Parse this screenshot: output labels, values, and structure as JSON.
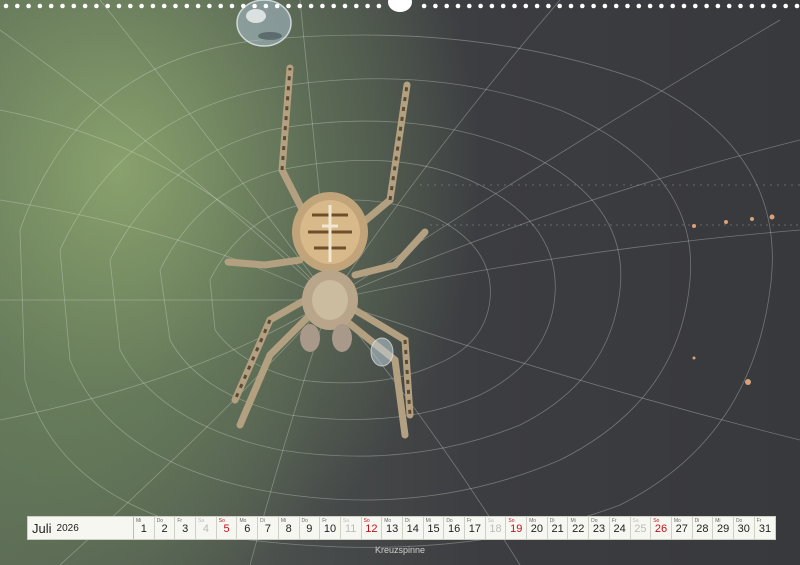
{
  "calendar": {
    "month": "Juli",
    "year": "2026",
    "days": [
      {
        "dow": "Mi",
        "num": "1",
        "type": "weekday"
      },
      {
        "dow": "Do",
        "num": "2",
        "type": "weekday"
      },
      {
        "dow": "Fr",
        "num": "3",
        "type": "weekday"
      },
      {
        "dow": "Sa",
        "num": "4",
        "type": "sat"
      },
      {
        "dow": "So",
        "num": "5",
        "type": "sun"
      },
      {
        "dow": "Mo",
        "num": "6",
        "type": "weekday"
      },
      {
        "dow": "Di",
        "num": "7",
        "type": "weekday"
      },
      {
        "dow": "Mi",
        "num": "8",
        "type": "weekday"
      },
      {
        "dow": "Do",
        "num": "9",
        "type": "weekday"
      },
      {
        "dow": "Fr",
        "num": "10",
        "type": "weekday"
      },
      {
        "dow": "Sa",
        "num": "11",
        "type": "sat"
      },
      {
        "dow": "So",
        "num": "12",
        "type": "sun"
      },
      {
        "dow": "Mo",
        "num": "13",
        "type": "weekday"
      },
      {
        "dow": "Di",
        "num": "14",
        "type": "weekday"
      },
      {
        "dow": "Mi",
        "num": "15",
        "type": "weekday"
      },
      {
        "dow": "Do",
        "num": "16",
        "type": "weekday"
      },
      {
        "dow": "Fr",
        "num": "17",
        "type": "weekday"
      },
      {
        "dow": "Sa",
        "num": "18",
        "type": "sat"
      },
      {
        "dow": "So",
        "num": "19",
        "type": "sun"
      },
      {
        "dow": "Mo",
        "num": "20",
        "type": "weekday"
      },
      {
        "dow": "Di",
        "num": "21",
        "type": "weekday"
      },
      {
        "dow": "Mi",
        "num": "22",
        "type": "weekday"
      },
      {
        "dow": "Do",
        "num": "23",
        "type": "weekday"
      },
      {
        "dow": "Fr",
        "num": "24",
        "type": "weekday"
      },
      {
        "dow": "Sa",
        "num": "25",
        "type": "sat"
      },
      {
        "dow": "So",
        "num": "26",
        "type": "sun"
      },
      {
        "dow": "Mo",
        "num": "27",
        "type": "weekday"
      },
      {
        "dow": "Di",
        "num": "28",
        "type": "weekday"
      },
      {
        "dow": "Mi",
        "num": "29",
        "type": "weekday"
      },
      {
        "dow": "Do",
        "num": "30",
        "type": "weekday"
      },
      {
        "dow": "Fr",
        "num": "31",
        "type": "weekday"
      }
    ]
  },
  "caption": "Kreuzspinne",
  "colors": {
    "sunday": "#c0101a",
    "saturday": "#bbbbbb",
    "background_green": "#8ca56e",
    "background_dark": "#38393d"
  }
}
